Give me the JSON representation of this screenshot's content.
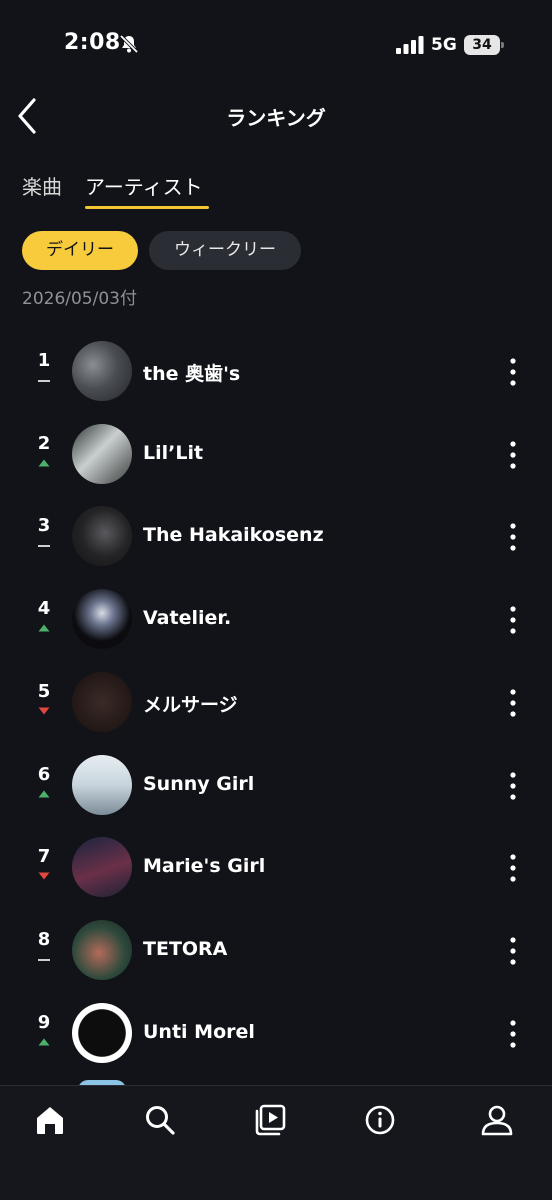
{
  "status_bar": {
    "time": "2:08",
    "network": "5G",
    "battery": "34"
  },
  "header": {
    "title": "ランキング"
  },
  "tabs": [
    {
      "label": "楽曲",
      "active": false
    },
    {
      "label": "アーティスト",
      "active": true
    }
  ],
  "filters": {
    "daily": "デイリー",
    "weekly": "ウィークリー",
    "selected": "デイリー"
  },
  "date": "2026/05/03付",
  "rankings": [
    {
      "rank": "1",
      "name": "the 奥歯's",
      "trend": "same"
    },
    {
      "rank": "2",
      "name": "Lil’Lit",
      "trend": "up"
    },
    {
      "rank": "3",
      "name": "The Hakaikosenz",
      "trend": "same"
    },
    {
      "rank": "4",
      "name": "Vatelier.",
      "trend": "up"
    },
    {
      "rank": "5",
      "name": "メルサージ",
      "trend": "down"
    },
    {
      "rank": "6",
      "name": "Sunny Girl",
      "trend": "up"
    },
    {
      "rank": "7",
      "name": "Marie's Girl",
      "trend": "down"
    },
    {
      "rank": "8",
      "name": "TETORA",
      "trend": "same"
    },
    {
      "rank": "9",
      "name": "Unti Morel",
      "trend": "up"
    }
  ],
  "colors": {
    "accent": "#f7cb3c",
    "up": "#4caf6a",
    "down": "#e0473e",
    "background": "#111318"
  },
  "bottom_nav": [
    {
      "icon": "home-icon",
      "active": true
    },
    {
      "icon": "search-icon",
      "active": false
    },
    {
      "icon": "playlist-icon",
      "active": false
    },
    {
      "icon": "info-icon",
      "active": false
    },
    {
      "icon": "account-icon",
      "active": false
    }
  ]
}
